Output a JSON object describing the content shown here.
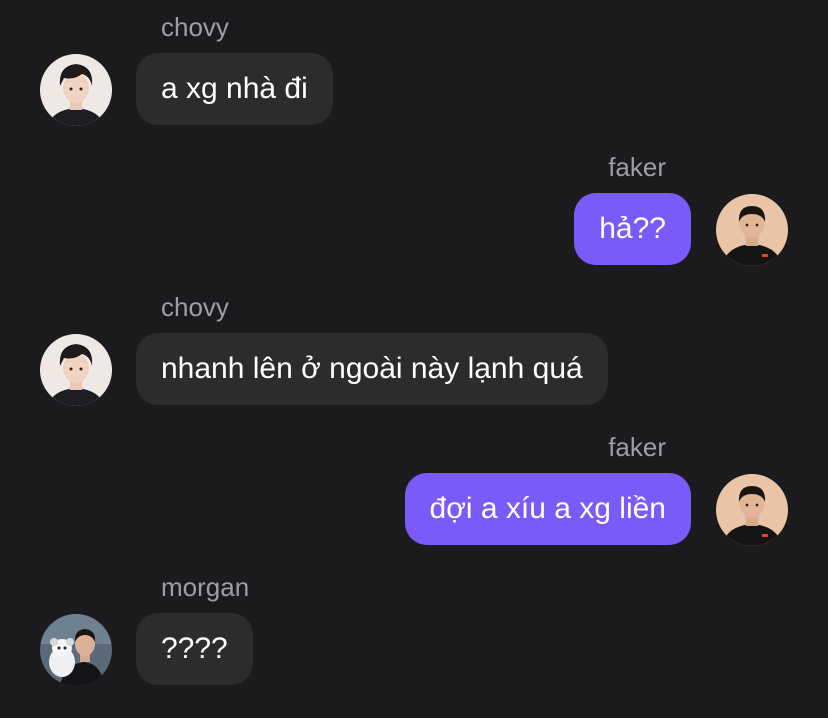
{
  "messages": [
    {
      "sender": "chovy",
      "text": "a xg nhà đi",
      "direction": "incoming",
      "avatar": "chovy-avatar"
    },
    {
      "sender": "faker",
      "text": "hả??",
      "direction": "outgoing",
      "avatar": "faker-avatar"
    },
    {
      "sender": "chovy",
      "text": "nhanh lên ở ngoài này lạnh quá",
      "direction": "incoming",
      "avatar": "chovy-avatar"
    },
    {
      "sender": "faker",
      "text": "đợi a xíu a xg liền",
      "direction": "outgoing",
      "avatar": "faker-avatar"
    },
    {
      "sender": "morgan",
      "text": "????",
      "direction": "incoming",
      "avatar": "morgan-avatar"
    }
  ],
  "colors": {
    "background": "#1b1b1d",
    "incoming_bubble": "#2c2c2e",
    "outgoing_bubble": "#7a5af8",
    "sender_name": "#9e9ea3",
    "message_text": "#ffffff"
  }
}
